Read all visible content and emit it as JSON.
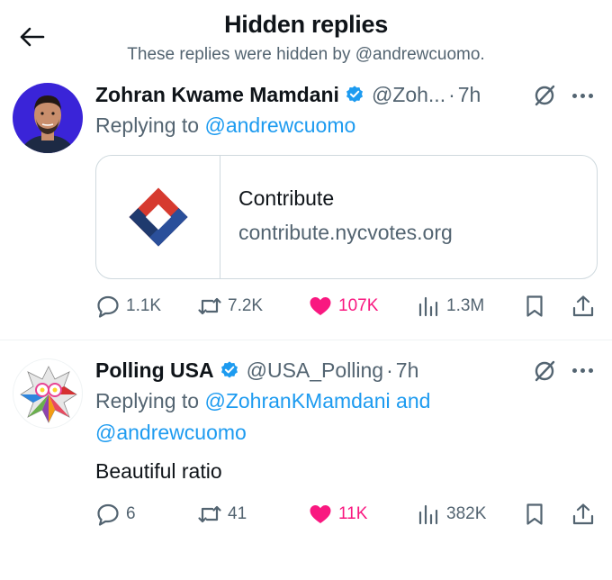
{
  "header": {
    "title": "Hidden replies",
    "subtitle": "These replies were hidden by @andrewcuomo."
  },
  "tweets": [
    {
      "display_name": "Zohran Kwame Mamdani",
      "handle": "@Zoh...",
      "separator": "·",
      "time": "7h",
      "replying_prefix": "Replying to",
      "replying_to": "@andrewcuomo",
      "card": {
        "title": "Contribute",
        "domain": "contribute.nycvotes.org"
      },
      "stats": {
        "replies": "1.1K",
        "reposts": "7.2K",
        "likes": "107K",
        "views": "1.3M"
      }
    },
    {
      "display_name": "Polling USA",
      "handle": "@USA_Polling",
      "separator": "·",
      "time": "7h",
      "replying_prefix": "Replying to",
      "replying_to": "@ZohranKMamdani",
      "replying_and": "and",
      "replying_to_2": "@andrewcuomo",
      "text": "Beautiful ratio",
      "stats": {
        "replies": "6",
        "reposts": "41",
        "likes": "11K",
        "views": "382K"
      }
    }
  ],
  "colors": {
    "accent": "#1d9bf0",
    "like": "#f91880",
    "secondary_text": "#536471",
    "border": "#cfd9de"
  },
  "icons": [
    "back-arrow-icon",
    "verified-badge-icon",
    "hidden-reply-icon",
    "more-icon",
    "reply-icon",
    "repost-icon",
    "like-icon",
    "views-icon",
    "bookmark-icon",
    "share-icon"
  ]
}
